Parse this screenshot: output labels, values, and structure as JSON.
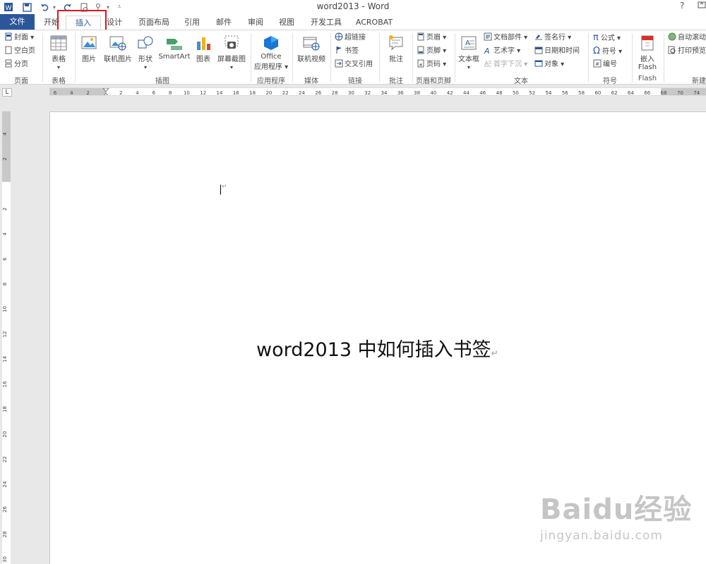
{
  "window": {
    "title": "word2013 - Word",
    "help": "?"
  },
  "tabs": {
    "file": "文件",
    "items": [
      "开始",
      "插入",
      "设计",
      "页面布局",
      "引用",
      "邮件",
      "审阅",
      "视图",
      "开发工具",
      "ACROBAT"
    ],
    "active": "插入"
  },
  "ribbon": {
    "pages": {
      "cover": "封面",
      "blank": "空白页",
      "break": "分页",
      "label": "页面"
    },
    "tables": {
      "table": "表格",
      "label": "表格"
    },
    "illustrations": {
      "picture": "图片",
      "online_picture": "联机图片",
      "shapes": "形状",
      "smartart": "SmartArt",
      "chart": "图表",
      "screenshot": "屏幕截图",
      "label": "插图"
    },
    "apps": {
      "office_line1": "Office",
      "office_line2": "应用程序",
      "label": "应用程序"
    },
    "media": {
      "online_video": "联机视频",
      "label": "媒体"
    },
    "links": {
      "hyperlink": "超链接",
      "bookmark": "书签",
      "cross_ref": "交叉引用",
      "label": "链接"
    },
    "comments": {
      "comment": "批注",
      "label": "批注"
    },
    "header_footer": {
      "header": "页眉",
      "footer": "页脚",
      "page_number": "页码",
      "label": "页眉和页脚"
    },
    "text": {
      "textbox": "文本框",
      "quick_parts": "文档部件",
      "wordart": "艺术字",
      "dropcap": "首字下沉",
      "signature": "签名行",
      "datetime": "日期和时间",
      "object": "对象",
      "label": "文本"
    },
    "symbols": {
      "equation": "公式",
      "symbol": "符号",
      "number": "编号",
      "label": "符号"
    },
    "flash": {
      "embed_line1": "嵌入",
      "embed_line2": "Flash",
      "label": "Flash"
    },
    "new_group": {
      "auto_scroll": "自动滚动",
      "print_preview": "打印预览",
      "label": "新建"
    }
  },
  "rulers": {
    "corner": "L",
    "horizontal_ticks": [
      "6",
      "4",
      "2",
      "",
      "2",
      "4",
      "6",
      "8",
      "10",
      "12",
      "14",
      "16",
      "18",
      "20",
      "22",
      "24",
      "26",
      "28",
      "30",
      "32",
      "34",
      "36",
      "38",
      "40",
      "42",
      "44",
      "46",
      "48",
      "50",
      "52",
      "54",
      "56",
      "58",
      "60",
      "62",
      "64",
      "66",
      "68",
      "70",
      "74"
    ],
    "vertical_ticks": [
      "4",
      "2",
      "",
      "2",
      "4",
      "6",
      "8",
      "10",
      "12",
      "14",
      "16",
      "18",
      "20",
      "22",
      "24",
      "26",
      "28",
      "30"
    ]
  },
  "document": {
    "body_text": "word2013 中如何插入书签",
    "para_mark": "↵"
  },
  "watermark": {
    "brand": "Baidu经验",
    "url": "jingyan.baidu.com"
  },
  "colors": {
    "accent": "#2b579a",
    "highlight_box": "#e0161a"
  }
}
